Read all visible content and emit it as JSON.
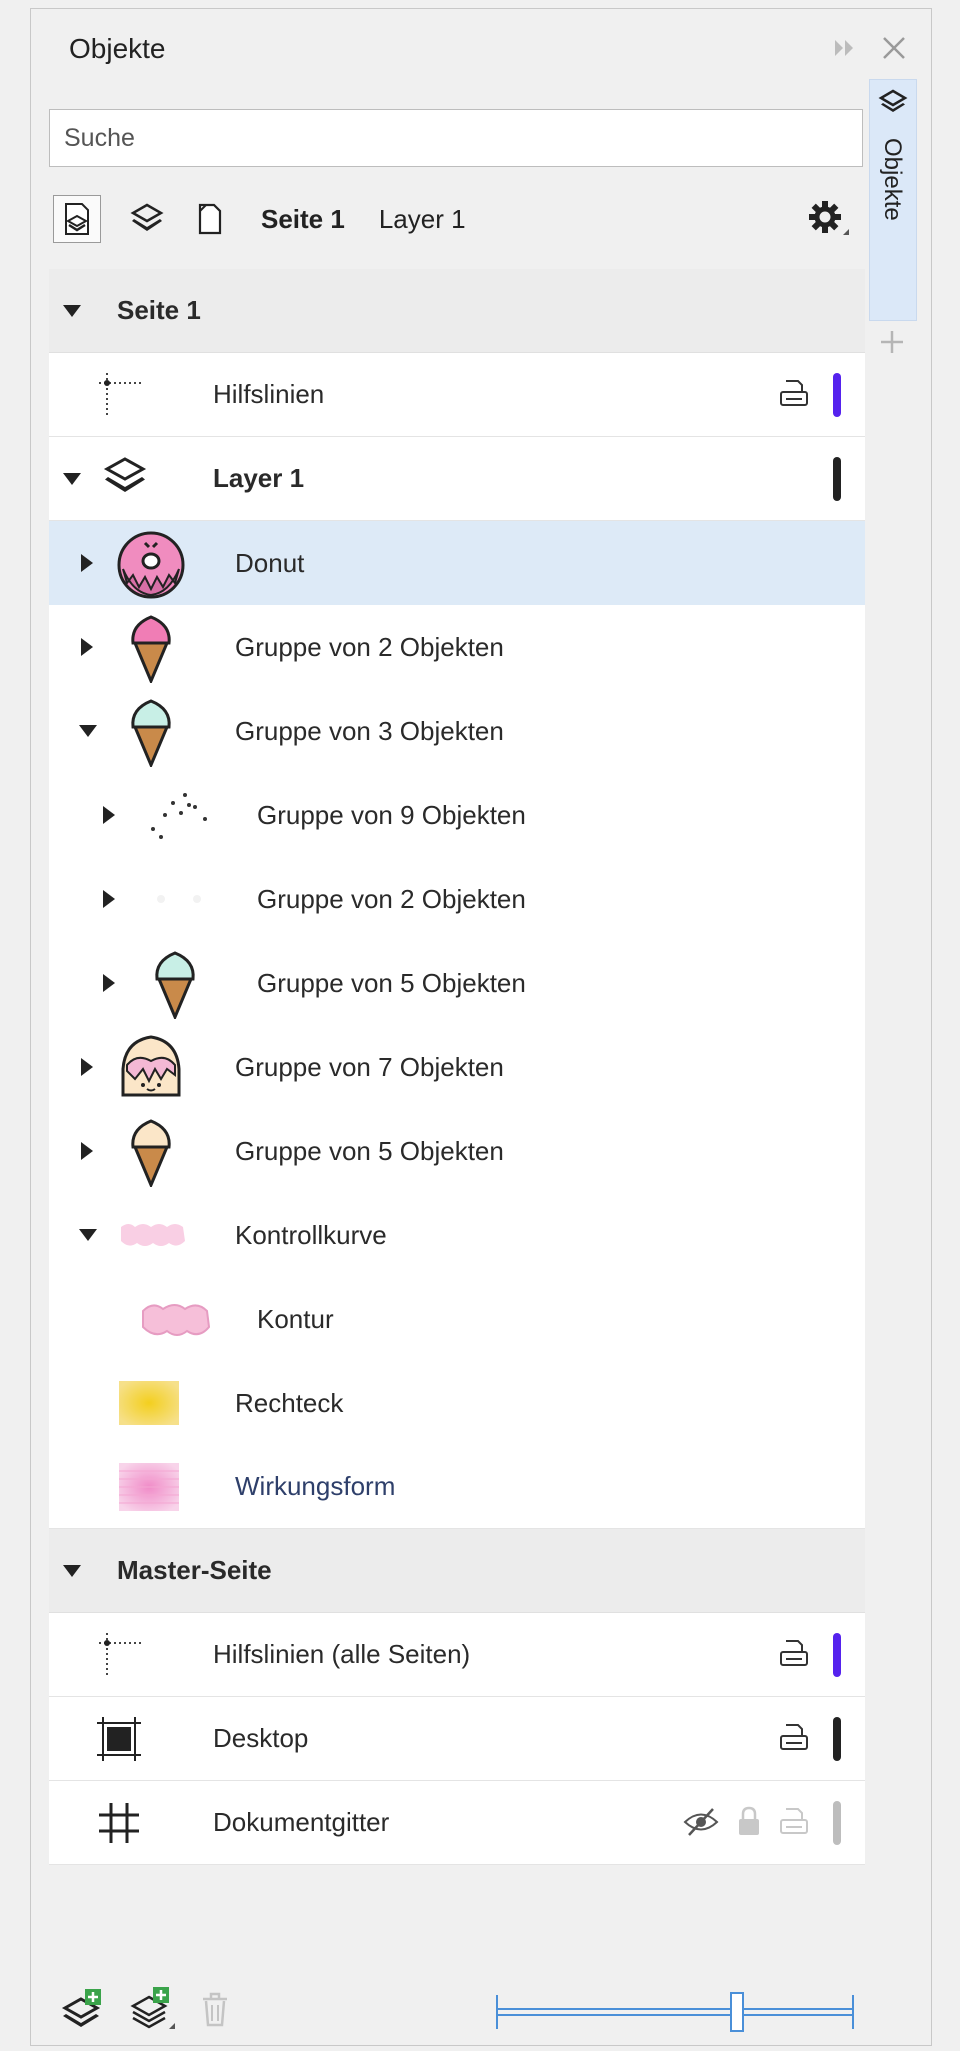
{
  "docker": {
    "title": "Objekte",
    "side_tab_label": "Objekte"
  },
  "search": {
    "placeholder": "Suche"
  },
  "toolbar": {
    "current_page": "Seite 1",
    "current_layer": "Layer 1"
  },
  "tree": {
    "page1": {
      "label": "Seite 1"
    },
    "guides": {
      "label": "Hilfslinien",
      "color": "#5522ee"
    },
    "layer1": {
      "label": "Layer 1",
      "color": "#222222"
    },
    "objects": [
      {
        "label": "Donut"
      },
      {
        "label": "Gruppe von 2 Objekten"
      },
      {
        "label": "Gruppe von 3 Objekten"
      },
      {
        "label": "Gruppe von 9 Objekten"
      },
      {
        "label": "Gruppe von 2 Objekten"
      },
      {
        "label": "Gruppe von 5 Objekten"
      },
      {
        "label": "Gruppe von 7 Objekten"
      },
      {
        "label": "Gruppe von 5 Objekten"
      },
      {
        "label": "Kontrollkurve"
      },
      {
        "label": "Kontur"
      },
      {
        "label": "Rechteck"
      },
      {
        "label": "Wirkungsform"
      }
    ],
    "master": {
      "label": "Master-Seite"
    },
    "master_guides": {
      "label": "Hilfslinien (alle Seiten)",
      "color": "#5522ee"
    },
    "desktop": {
      "label": "Desktop",
      "color": "#222222"
    },
    "grid": {
      "label": "Dokumentgitter",
      "color": "#bdbdbd"
    }
  },
  "colors": {
    "selection": "#ddeaf7",
    "accent_tab": "#dbe8f8",
    "donut_pink": "#f08cbf",
    "cream": "#fbe6c8",
    "cone": "#c98a4a"
  },
  "icons": {
    "collapse": "double-chevron-right-icon",
    "close": "close-icon",
    "settings": "gear-icon",
    "new_layer": "new-layer-icon",
    "new_master_layer": "new-master-layer-icon",
    "delete": "trash-icon"
  }
}
